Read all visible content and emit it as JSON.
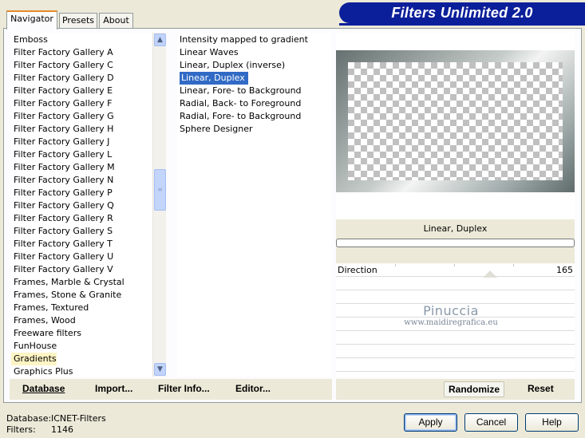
{
  "header": {
    "title": "Filters Unlimited 2.0"
  },
  "tabs": [
    {
      "label": "Navigator",
      "active": true
    },
    {
      "label": "Presets",
      "active": false
    },
    {
      "label": "About",
      "active": false
    }
  ],
  "categories": {
    "items": [
      "Emboss",
      "Filter Factory Gallery A",
      "Filter Factory Gallery C",
      "Filter Factory Gallery D",
      "Filter Factory Gallery E",
      "Filter Factory Gallery F",
      "Filter Factory Gallery G",
      "Filter Factory Gallery H",
      "Filter Factory Gallery J",
      "Filter Factory Gallery L",
      "Filter Factory Gallery M",
      "Filter Factory Gallery N",
      "Filter Factory Gallery P",
      "Filter Factory Gallery Q",
      "Filter Factory Gallery R",
      "Filter Factory Gallery S",
      "Filter Factory Gallery T",
      "Filter Factory Gallery U",
      "Filter Factory Gallery V",
      "Frames, Marble & Crystal",
      "Frames, Stone & Granite",
      "Frames, Textured",
      "Frames, Wood",
      "Freeware filters",
      "FunHouse",
      "Gradients",
      "Graphics Plus"
    ],
    "selected": "Gradients"
  },
  "filters": {
    "items": [
      "Intensity mapped to gradient",
      "Linear Waves",
      "Linear, Duplex (inverse)",
      "Linear, Duplex",
      "Linear, Fore- to Background",
      "Radial, Back- to Foreground",
      "Radial, Fore- to Background",
      "Sphere Designer"
    ],
    "selected": "Linear, Duplex"
  },
  "preview": {
    "filter_name": "Linear, Duplex",
    "parameters": [
      {
        "label": "Direction",
        "value": "165"
      }
    ],
    "watermark_name": "Pinuccia",
    "watermark_url": "www.maidiregrafica.eu"
  },
  "toolbar": {
    "database": "Database",
    "import": "Import...",
    "filter_info": "Filter Info...",
    "editor": "Editor...",
    "randomize": "Randomize",
    "reset": "Reset"
  },
  "status": {
    "database_label": "Database:",
    "database_value": "ICNET-Filters",
    "filters_label": "Filters:",
    "filters_value": "1146"
  },
  "buttons": {
    "apply": "Apply",
    "cancel": "Cancel",
    "help": "Help"
  }
}
